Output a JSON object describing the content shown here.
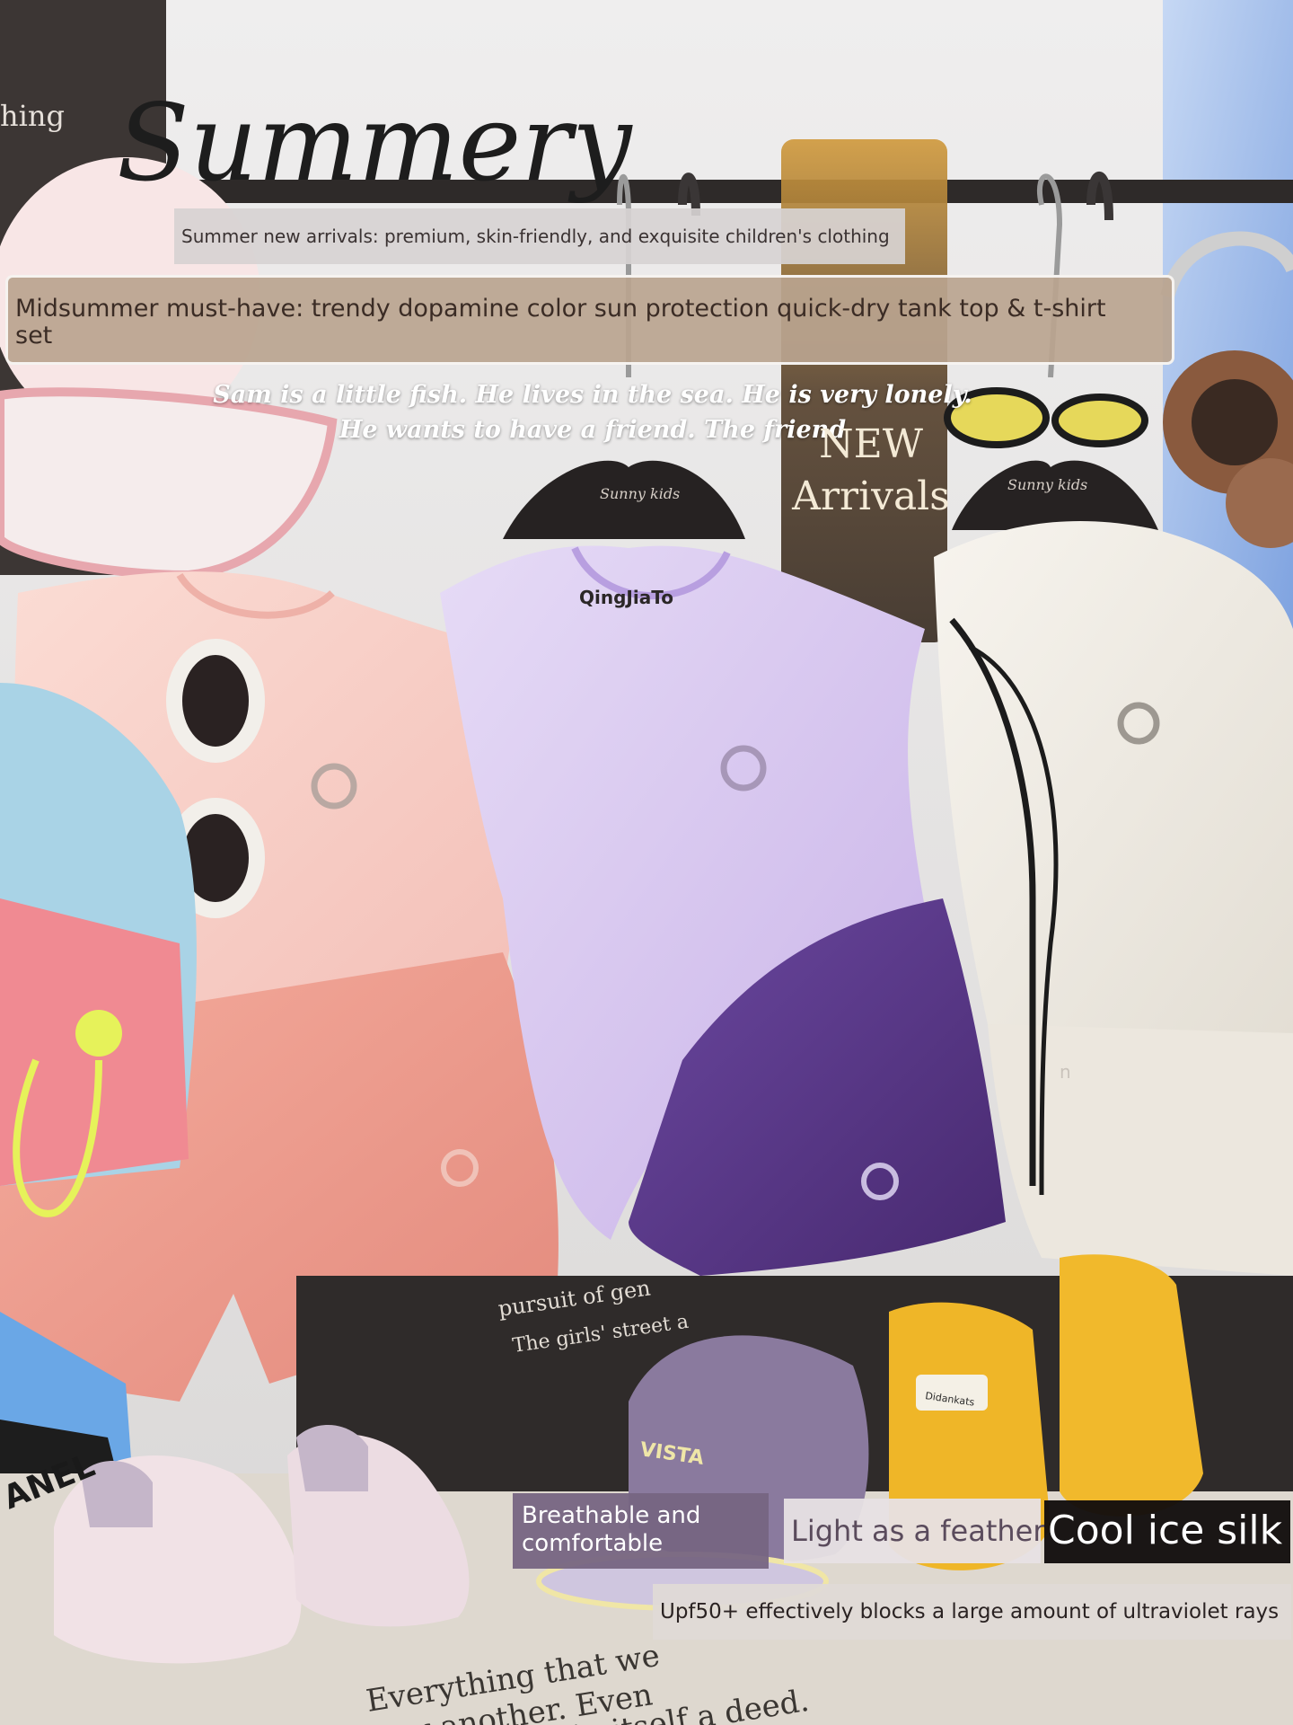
{
  "brand_script": "Summery",
  "subtitle": "Summer new arrivals: premium, skin-friendly, and exquisite children's clothing",
  "headline": "Midsummer must-have: trendy dopamine color sun protection quick-dry tank top & t-shirt set",
  "story_lines": [
    "Sam is a little fish. He lives in the sea. He is very lonely.",
    "He wants to have a friend. The friend"
  ],
  "new_arrivals": [
    "NEW",
    "Arrivals"
  ],
  "features": {
    "breathable": "Breathable and comfortable",
    "feather": "Light as a feather",
    "ice_silk": "Cool ice silk"
  },
  "uv_protection": "Upf50+ effectively blocks a large amount of ultraviolet rays",
  "background_lettering": {
    "top_left": "hing",
    "hanger_brand": "Sunny kids",
    "hanger_print": "QingJiaTo",
    "book_line_1": "pursuit of gen",
    "book_line_2": "The girls' street a",
    "bag_logo": "ANEL",
    "cap_logo": "VISTA",
    "boot_label": "Didankats",
    "bottom_line_1": "Everything that we",
    "bottom_line_2": "ection or another. Even",
    "bottom_line_3": "in itself a deed.",
    "shirt_monogram": "n"
  },
  "colors": {
    "pink_top": "#f6c9c2",
    "lilac_top": "#d9c7ef",
    "cream_top": "#f1ede5",
    "coral_shorts": "#ee9a8c",
    "purple_shorts": "#5b3a8c",
    "yellow_boots": "#efb628",
    "overlay_beige": "#baa48f",
    "overlay_purple": "#766582"
  }
}
